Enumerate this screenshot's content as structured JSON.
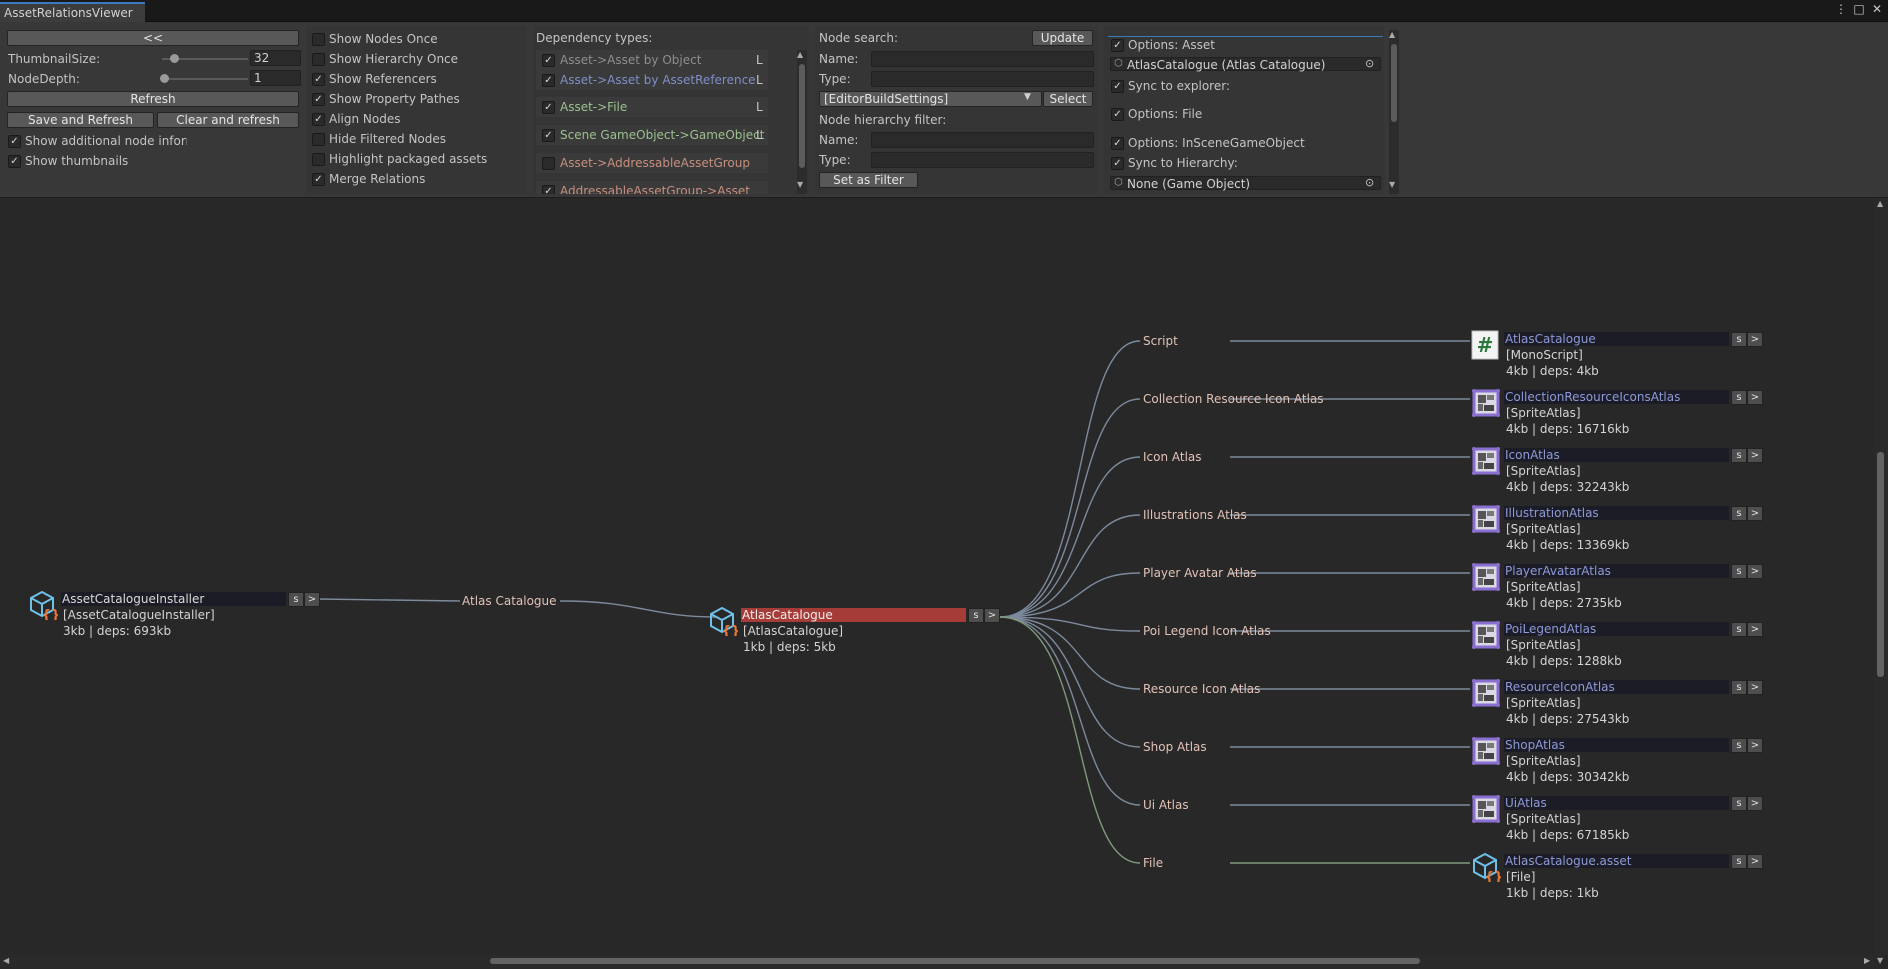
{
  "window": {
    "tab_title": "AssetRelationsViewer",
    "controls": [
      "⋮",
      "□",
      "✕"
    ]
  },
  "left_panel": {
    "collapse_label": "<<",
    "thumbnail_size_label": "ThumbnailSize:",
    "thumbnail_size_value": "32",
    "node_depth_label": "NodeDepth:",
    "node_depth_value": "1",
    "refresh_label": "Refresh",
    "save_refresh_label": "Save and Refresh",
    "clear_refresh_label": "Clear and refresh",
    "show_additional_label": "Show additional node informa",
    "show_additional_checked": true,
    "show_thumbnails_label": "Show thumbnails",
    "show_thumbnails_checked": true
  },
  "display_options": [
    {
      "label": "Show Nodes Once",
      "checked": false
    },
    {
      "label": "Show Hierarchy Once",
      "checked": false
    },
    {
      "label": "Show Referencers",
      "checked": true
    },
    {
      "label": "Show Property Pathes",
      "checked": true
    },
    {
      "label": "Align Nodes",
      "checked": true
    },
    {
      "label": "Hide Filtered Nodes",
      "checked": false
    },
    {
      "label": "Highlight packaged assets",
      "checked": false
    },
    {
      "label": "Merge Relations",
      "checked": true
    }
  ],
  "dependency": {
    "title": "Dependency types:",
    "items": [
      {
        "label": "Asset->Asset by Object",
        "checked": true,
        "color": "#8e8e8e",
        "flag": "L"
      },
      {
        "label": "Asset->Asset by AssetReference",
        "checked": true,
        "color": "#7f8fc8",
        "flag": "L"
      },
      {
        "label": "Asset->File",
        "checked": true,
        "color": "#9bc08f",
        "flag": "L"
      },
      {
        "label": "Scene GameObject->GameObject",
        "checked": true,
        "color": "#9bc08f",
        "flag": "L"
      },
      {
        "label": "Asset->AddressableAssetGroup",
        "checked": false,
        "color": "#c88f7f",
        "flag": ""
      },
      {
        "label": "AddressableAssetGroup->Asset",
        "checked": true,
        "color": "#c88f7f",
        "flag": ""
      }
    ]
  },
  "search": {
    "title": "Node search:",
    "update_label": "Update",
    "name_label": "Name:",
    "name_value": "",
    "type_label": "Type:",
    "type_value": "",
    "dropdown_value": "[EditorBuildSettings]",
    "select_label": "Select",
    "hier_title": "Node hierarchy filter:",
    "hier_name_label": "Name:",
    "hier_name_value": "",
    "hier_type_label": "Type:",
    "hier_type_value": "",
    "set_filter_label": "Set as Filter"
  },
  "options": {
    "asset_label": "Options: Asset",
    "asset_checked": true,
    "asset_object": "AtlasCatalogue (Atlas Catalogue)",
    "sync_explorer_label": "Sync to explorer:",
    "sync_explorer_checked": true,
    "file_label": "Options: File",
    "file_checked": true,
    "inscene_label": "Options: InSceneGameObject",
    "inscene_checked": true,
    "sync_hier_label": "Sync to Hierarchy:",
    "sync_hier_checked": true,
    "none_object": "None (Game Object)"
  },
  "graph": {
    "left_node": {
      "name": "AssetCatalogueInstaller",
      "type": "[AssetCatalogueInstaller]",
      "info": "3kb | deps: 693kb",
      "icon": "scriptable-object-icon"
    },
    "left_edge_label": "Atlas Catalogue",
    "center_node": {
      "name": "AtlasCatalogue",
      "type": "[AtlasCatalogue]",
      "info": "1kb | deps: 5kb",
      "icon": "scriptable-object-icon"
    },
    "edge_labels": [
      "Script",
      "Collection Resource Icon Atlas",
      "Icon Atlas",
      "Illustrations Atlas",
      "Player Avatar Atlas",
      "Poi Legend Icon Atlas",
      "Resource Icon Atlas",
      "Shop Atlas",
      "Ui Atlas",
      "File"
    ],
    "right_nodes": [
      {
        "name": "AtlasCatalogue",
        "type": "[MonoScript]",
        "info": "4kb | deps: 4kb",
        "icon": "csharp-script-icon"
      },
      {
        "name": "CollectionResourceIconsAtlas",
        "type": "[SpriteAtlas]",
        "info": "4kb | deps: 16716kb",
        "icon": "sprite-atlas-icon"
      },
      {
        "name": "IconAtlas",
        "type": "[SpriteAtlas]",
        "info": "4kb | deps: 32243kb",
        "icon": "sprite-atlas-icon"
      },
      {
        "name": "IllustrationAtlas",
        "type": "[SpriteAtlas]",
        "info": "4kb | deps: 13369kb",
        "icon": "sprite-atlas-icon"
      },
      {
        "name": "PlayerAvatarAtlas",
        "type": "[SpriteAtlas]",
        "info": "4kb | deps: 2735kb",
        "icon": "sprite-atlas-icon"
      },
      {
        "name": "PoiLegendAtlas",
        "type": "[SpriteAtlas]",
        "info": "4kb | deps: 1288kb",
        "icon": "sprite-atlas-icon"
      },
      {
        "name": "ResourceIconAtlas",
        "type": "[SpriteAtlas]",
        "info": "4kb | deps: 27543kb",
        "icon": "sprite-atlas-icon"
      },
      {
        "name": "ShopAtlas",
        "type": "[SpriteAtlas]",
        "info": "4kb | deps: 30342kb",
        "icon": "sprite-atlas-icon"
      },
      {
        "name": "UiAtlas",
        "type": "[SpriteAtlas]",
        "info": "4kb | deps: 67185kb",
        "icon": "sprite-atlas-icon"
      },
      {
        "name": "AtlasCatalogue.asset",
        "type": "[File]",
        "info": "1kb | deps: 1kb",
        "icon": "file-asset-icon"
      }
    ],
    "node_button_s": "s",
    "node_button_next": ">"
  },
  "colors": {
    "selected": "#a63c37",
    "edge": "#7c8a9c",
    "edge_file": "#7e9a7a",
    "label": "#e2c2b7"
  }
}
